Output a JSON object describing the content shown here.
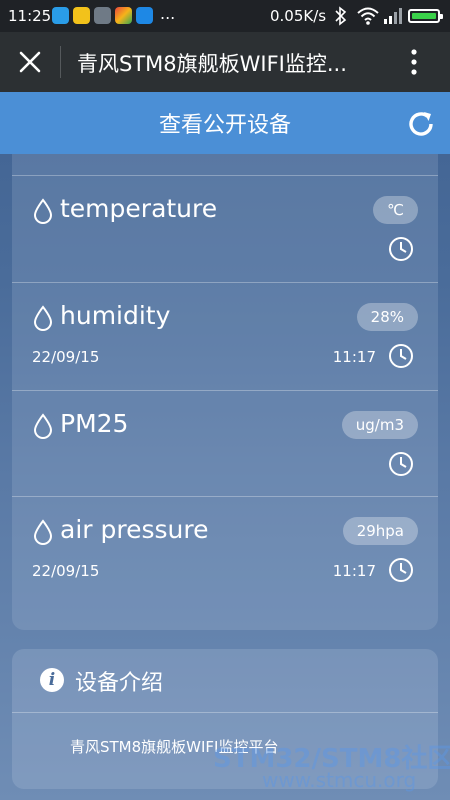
{
  "status_bar": {
    "time": "11:25",
    "more": "...",
    "net_speed": "0.05K/s"
  },
  "title_bar": {
    "title": "青风STM8旗舰板WIFI监控..."
  },
  "header": {
    "title": "查看公开设备"
  },
  "devices": [
    {
      "name": "temperature",
      "value": "℃",
      "date": "",
      "time": ""
    },
    {
      "name": "humidity",
      "value": "28%",
      "date": "22/09/15",
      "time": "11:17"
    },
    {
      "name": "PM25",
      "value": "ug/m3",
      "date": "",
      "time": ""
    },
    {
      "name": "air pressure",
      "value": "29hpa",
      "date": "22/09/15",
      "time": "11:17"
    }
  ],
  "info": {
    "title": "设备介绍",
    "description": "青风STM8旗舰板WIFI监控平台"
  },
  "watermark": {
    "line1": "STM32/STM8社区",
    "line2": "www.stmcu.org"
  },
  "colors": {
    "header_bg": "#4b8fd6",
    "title_bar_bg": "#2c3033",
    "battery_fill": "#3ad14a"
  }
}
